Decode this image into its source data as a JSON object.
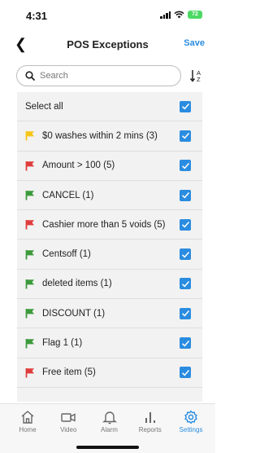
{
  "status": {
    "time": "4:31",
    "battery": "72"
  },
  "nav": {
    "title": "POS Exceptions",
    "save_label": "Save"
  },
  "search": {
    "placeholder": "Search",
    "value": ""
  },
  "list": {
    "select_all_label": "Select all",
    "items": [
      {
        "label": "$0 washes within 2 mins (3)",
        "flag_color": "#f5c518",
        "checked": true
      },
      {
        "label": "Amount > 100 (5)",
        "flag_color": "#e03b3b",
        "checked": true
      },
      {
        "label": "CANCEL (1)",
        "flag_color": "#3b9a3b",
        "checked": true
      },
      {
        "label": "Cashier more than 5 voids (5)",
        "flag_color": "#e03b3b",
        "checked": true
      },
      {
        "label": "Centsoff (1)",
        "flag_color": "#3b9a3b",
        "checked": true
      },
      {
        "label": "deleted items (1)",
        "flag_color": "#3b9a3b",
        "checked": true
      },
      {
        "label": "DISCOUNT (1)",
        "flag_color": "#3b9a3b",
        "checked": true
      },
      {
        "label": "Flag 1 (1)",
        "flag_color": "#3b9a3b",
        "checked": true
      },
      {
        "label": "Free item (5)",
        "flag_color": "#e03b3b",
        "checked": true
      }
    ]
  },
  "tabbar": {
    "tabs": [
      {
        "label": "Home",
        "icon": "home-icon",
        "active": false
      },
      {
        "label": "Video",
        "icon": "video-icon",
        "active": false
      },
      {
        "label": "Alarm",
        "icon": "bell-icon",
        "active": false
      },
      {
        "label": "Reports",
        "icon": "bar-chart-icon",
        "active": false
      },
      {
        "label": "Settings",
        "icon": "gear-icon",
        "active": true
      }
    ]
  },
  "colors": {
    "accent": "#2a8ce0",
    "list_bg": "#f2f2f2"
  }
}
